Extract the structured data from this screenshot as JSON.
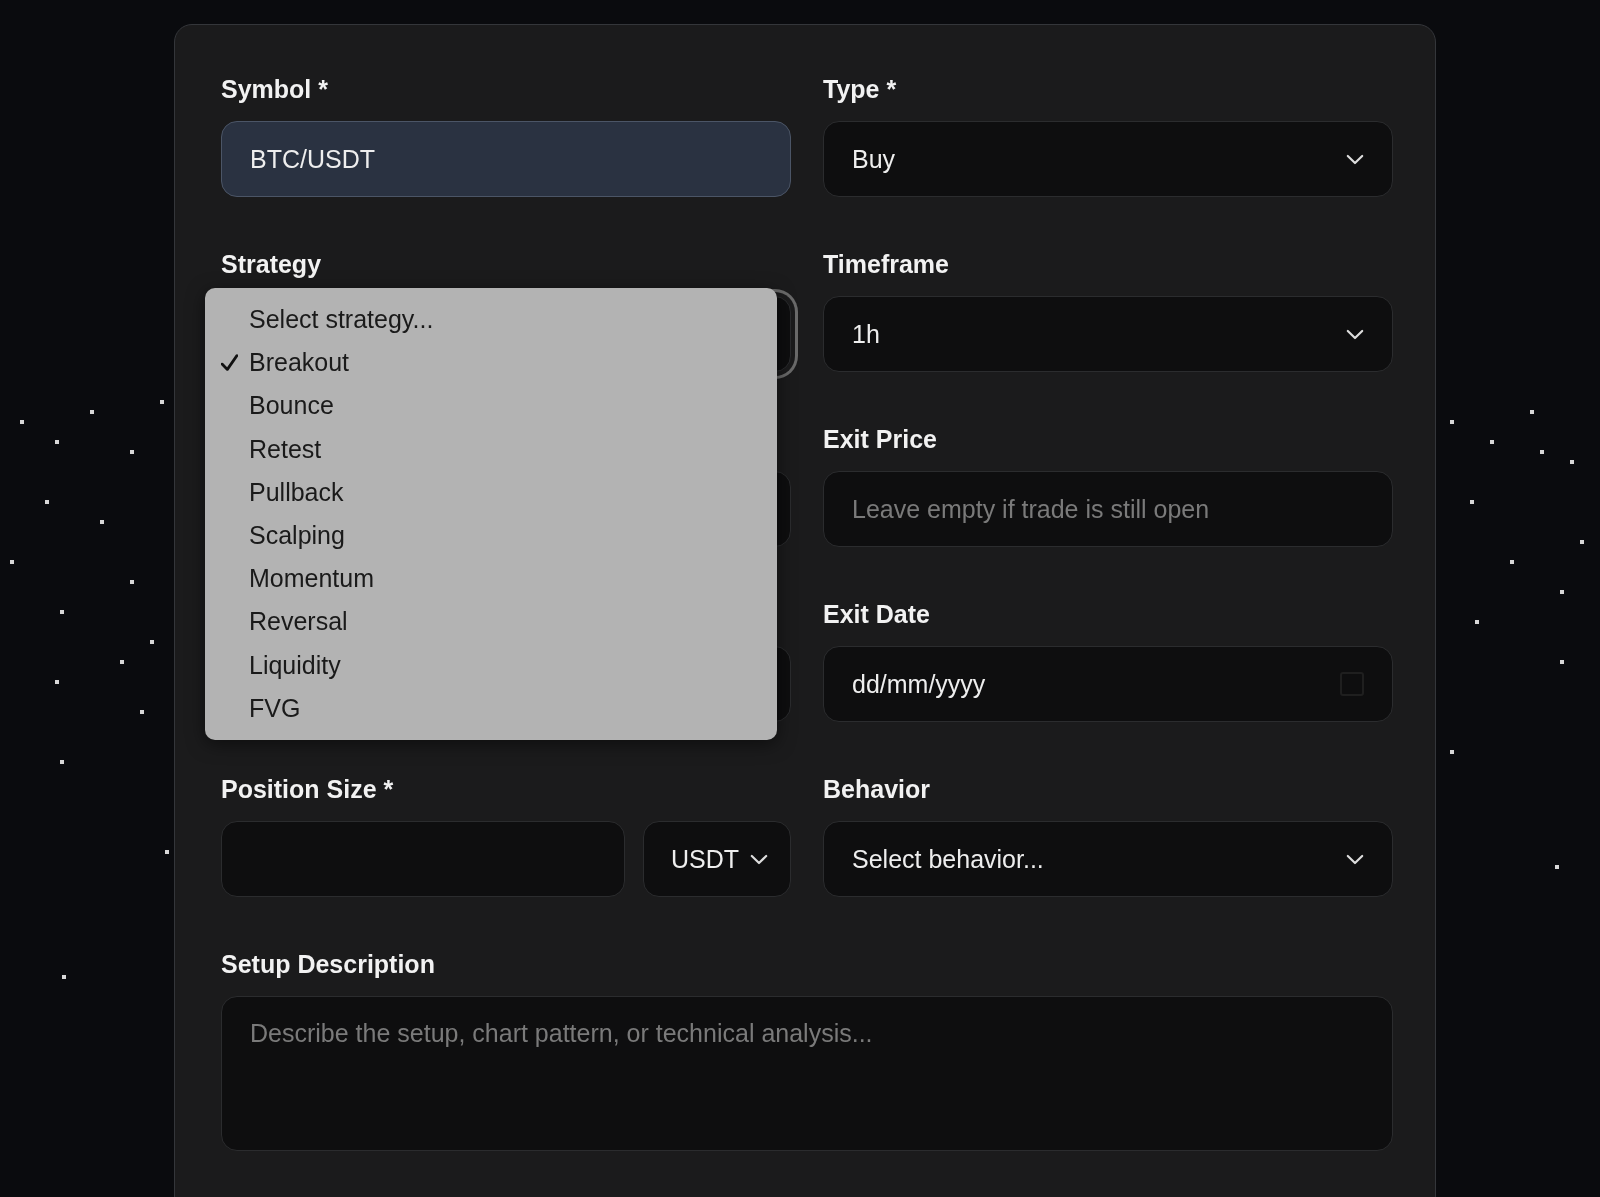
{
  "form": {
    "fields": [
      {
        "kind": "text",
        "label": "Symbol *",
        "value": "BTC/USDT",
        "autofilled": true
      },
      {
        "kind": "select",
        "label": "Type *",
        "value": "Buy"
      },
      {
        "kind": "select",
        "label": "Strategy",
        "open": true,
        "options": [
          {
            "label": "Select strategy...",
            "selected": false
          },
          {
            "label": "Breakout",
            "selected": true
          },
          {
            "label": "Bounce",
            "selected": false
          },
          {
            "label": "Retest",
            "selected": false
          },
          {
            "label": "Pullback",
            "selected": false
          },
          {
            "label": "Scalping",
            "selected": false
          },
          {
            "label": "Momentum",
            "selected": false
          },
          {
            "label": "Reversal",
            "selected": false
          },
          {
            "label": "Liquidity",
            "selected": false
          },
          {
            "label": "FVG",
            "selected": false
          }
        ]
      },
      {
        "kind": "select",
        "label": "Timeframe",
        "value": "1h"
      },
      {
        "kind": "text"
      },
      {
        "kind": "text",
        "label": "Exit Price",
        "placeholder": "Leave empty if trade is still open"
      },
      {
        "kind": "text"
      },
      {
        "kind": "date",
        "label": "Exit Date",
        "value": "dd/mm/yyyy"
      },
      {
        "kind": "split",
        "label": "Position Size *",
        "unit": "USDT"
      },
      {
        "kind": "select",
        "label": "Behavior",
        "value": "Select behavior..."
      },
      {
        "kind": "textarea",
        "label": "Setup Description",
        "placeholder": "Describe the setup, chart pattern, or technical analysis..."
      }
    ]
  }
}
